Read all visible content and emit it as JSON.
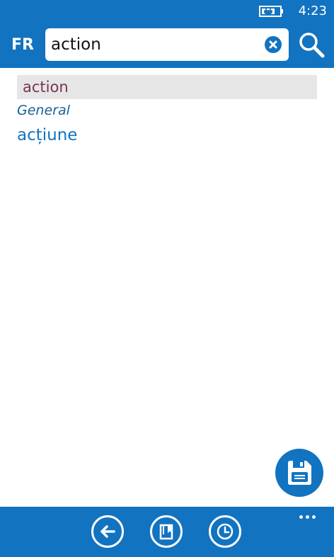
{
  "status_bar": {
    "battery_icon": "battery-charging-icon",
    "time": "4:23"
  },
  "header": {
    "language": "FR",
    "search": {
      "value": "action",
      "clear_icon": "clear-icon",
      "search_icon": "magnifier-icon"
    }
  },
  "entry": {
    "headword": "action",
    "category": "General",
    "translation": "acțiune"
  },
  "save_button": {
    "icon": "floppy-disk-icon"
  },
  "app_bar": {
    "buttons": [
      {
        "icon": "back-arrow-icon"
      },
      {
        "icon": "bookmark-book-icon"
      },
      {
        "icon": "history-clock-icon"
      }
    ],
    "more_icon": "ellipsis-icon"
  },
  "colors": {
    "accent": "#1273c0",
    "headword": "#7a3256",
    "category": "#1a5f94",
    "highlight": "#e6e6e6"
  }
}
